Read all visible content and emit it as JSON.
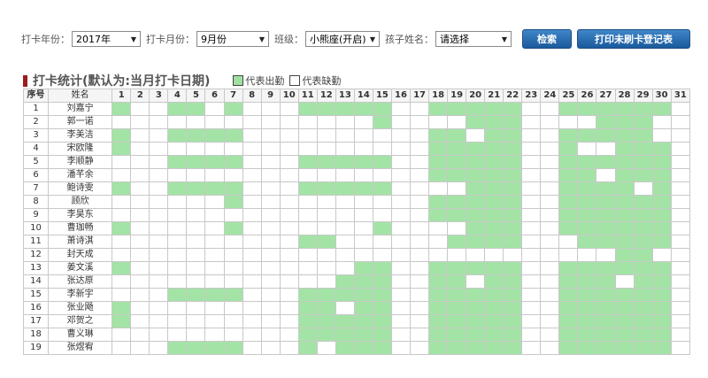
{
  "filters": {
    "year_label": "打卡年份：",
    "year_value": "2017年",
    "month_label": "打卡月份：",
    "month_value": "9月份",
    "class_label": "班级：",
    "class_value": "小熊座(开启)",
    "child_label": "孩子姓名：",
    "child_value": "请选择",
    "search_button": "检索",
    "print_button": "打印未刷卡登记表"
  },
  "section": {
    "title": "打卡统计(默认为:当月打卡日期)",
    "legend_present": "代表出勤",
    "legend_absent": "代表缺勤",
    "present_color": "#a3e4a6"
  },
  "table": {
    "col_index": "序号",
    "col_name": "姓名",
    "days": [
      "1",
      "2",
      "3",
      "4",
      "5",
      "6",
      "7",
      "8",
      "9",
      "10",
      "11",
      "12",
      "13",
      "14",
      "15",
      "16",
      "17",
      "18",
      "19",
      "20",
      "21",
      "22",
      "23",
      "24",
      "25",
      "26",
      "27",
      "28",
      "29",
      "30",
      "31"
    ],
    "rows": [
      {
        "no": "1",
        "name": "刘嘉宁",
        "present": [
          1,
          4,
          5,
          7,
          11,
          12,
          13,
          14,
          15,
          18,
          19,
          20,
          21,
          22,
          25,
          26,
          27,
          28,
          29,
          30
        ]
      },
      {
        "no": "2",
        "name": "郭一诺",
        "present": [
          15,
          20,
          21,
          22,
          27,
          28,
          29
        ]
      },
      {
        "no": "3",
        "name": "李美洁",
        "present": [
          1,
          4,
          5,
          6,
          7,
          18,
          19,
          21,
          22,
          25,
          26,
          27,
          28,
          29
        ]
      },
      {
        "no": "4",
        "name": "宋欧隆",
        "present": [
          1,
          18,
          19,
          20,
          21,
          22,
          25,
          28,
          29,
          30
        ]
      },
      {
        "no": "5",
        "name": "李顺静",
        "present": [
          4,
          5,
          6,
          7,
          11,
          12,
          13,
          14,
          15,
          18,
          19,
          20,
          21,
          22,
          25,
          26,
          27,
          28,
          29,
          30
        ]
      },
      {
        "no": "6",
        "name": "潘芊余",
        "present": [
          18,
          19,
          20,
          21,
          22,
          25,
          26,
          28,
          29,
          30
        ]
      },
      {
        "no": "7",
        "name": "鲍诗雯",
        "present": [
          1,
          4,
          5,
          6,
          7,
          11,
          12,
          13,
          14,
          15,
          20,
          21,
          22,
          25,
          26,
          27,
          28,
          30
        ]
      },
      {
        "no": "8",
        "name": "顾欣",
        "present": [
          7,
          18,
          19,
          20,
          21,
          22,
          25,
          26,
          27,
          28,
          29,
          30
        ]
      },
      {
        "no": "9",
        "name": "李昊东",
        "present": [
          18,
          19,
          20,
          21,
          22,
          25,
          26,
          27,
          28,
          29,
          30
        ]
      },
      {
        "no": "10",
        "name": "曹珈畅",
        "present": [
          1,
          7,
          15,
          20,
          21,
          22,
          25,
          26,
          27,
          28,
          29,
          30
        ]
      },
      {
        "no": "11",
        "name": "萧诗淇",
        "present": [
          11,
          12,
          19,
          20,
          21,
          22,
          26,
          27,
          28,
          29,
          30
        ]
      },
      {
        "no": "12",
        "name": "封天成",
        "present": [
          28,
          29
        ]
      },
      {
        "no": "13",
        "name": "姜文溪",
        "present": [
          1,
          14,
          15,
          18,
          19,
          20,
          21,
          22,
          25,
          26,
          27,
          28,
          29,
          30
        ]
      },
      {
        "no": "14",
        "name": "张达原",
        "present": [
          13,
          14,
          15,
          18,
          19,
          21,
          22,
          25,
          26,
          27,
          29,
          30
        ]
      },
      {
        "no": "15",
        "name": "李新宇",
        "present": [
          4,
          5,
          6,
          7,
          11,
          12,
          13,
          14,
          15,
          18,
          19,
          20,
          21,
          22,
          25,
          26,
          27,
          28,
          29,
          30
        ]
      },
      {
        "no": "16",
        "name": "张业飏",
        "present": [
          1,
          11,
          12,
          14,
          15,
          18,
          19,
          20,
          21,
          22,
          25,
          26,
          27,
          28,
          29,
          30
        ]
      },
      {
        "no": "17",
        "name": "邓贺之",
        "present": [
          1,
          11,
          12,
          13,
          14,
          15,
          18,
          19,
          20,
          21,
          22,
          25,
          26,
          27,
          28,
          29,
          30
        ]
      },
      {
        "no": "18",
        "name": "曹义琳",
        "present": [
          11,
          12,
          13,
          14,
          15,
          18,
          19,
          20,
          21,
          22,
          25,
          26,
          27,
          28,
          29,
          30
        ]
      },
      {
        "no": "19",
        "name": "张煜宥",
        "present": [
          4,
          5,
          6,
          7,
          11,
          13,
          14,
          15,
          18,
          19,
          20,
          21,
          22,
          25,
          26,
          27,
          28,
          29,
          30
        ]
      }
    ]
  }
}
